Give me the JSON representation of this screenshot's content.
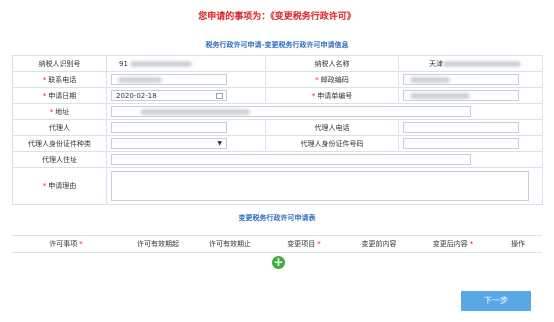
{
  "page": {
    "title": "您申请的事项为：《变更税务行政许可》",
    "section_info_title": "税务行政许可申请-变更税务行政许可申请信息",
    "section_apply_title": "变更税务行政许可申请表",
    "next_button": "下一步"
  },
  "form": {
    "taxpayer_id_label": "纳税人识别号",
    "taxpayer_id_value": "91",
    "taxpayer_name_label": "纳税人名称",
    "taxpayer_name_value": "天津",
    "phone_label": "联系电话",
    "postcode_label": "邮政编码",
    "apply_date_label": "申请日期",
    "apply_date_value": "2020-02-18",
    "apply_no_label": "申请单编号",
    "address_label": "地址",
    "agent_label": "代理人",
    "agent_phone_label": "代理人电话",
    "agent_id_type_label": "代理人身份证件种类",
    "agent_id_no_label": "代理人身份证件号码",
    "agent_address_label": "代理人住址",
    "reason_label": "申请理由"
  },
  "apply_table": {
    "headers": [
      "许可事项",
      "许可有效期起",
      "许可有效期止",
      "变更项目",
      "变更前内容",
      "变更后内容",
      "操作"
    ],
    "required": [
      true,
      false,
      false,
      true,
      false,
      true,
      false
    ]
  },
  "colors": {
    "title_red": "#e02020",
    "section_blue": "#2f6dbb",
    "button_blue": "#5aa7e8",
    "add_green": "#3fae3f"
  },
  "icons": {
    "calendar": "calendar-icon",
    "dropdown": "chevron-down-icon",
    "add": "plus-circle-icon"
  }
}
